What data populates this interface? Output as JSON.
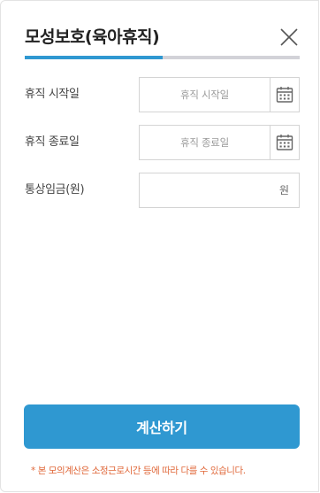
{
  "dialog": {
    "title": "모성보호(육아휴직)",
    "progress_fraction": 0.5,
    "accent_color": "#2f98d1",
    "icons": {
      "close": "close-icon",
      "calendar": "calendar-icon"
    }
  },
  "form": {
    "leave_start": {
      "label": "휴직 시작일",
      "placeholder": "휴직 시작일"
    },
    "leave_end": {
      "label": "휴직 종료일",
      "placeholder": "휴직 종료일"
    },
    "ordinary_wage": {
      "label": "통상임금(원)",
      "unit": "원"
    }
  },
  "actions": {
    "calculate_label": "계산하기"
  },
  "notice": {
    "text": "* 본 모의계산은 소정근로시간 등에 따라 다를 수 있습니다.",
    "color": "#e0683a"
  }
}
